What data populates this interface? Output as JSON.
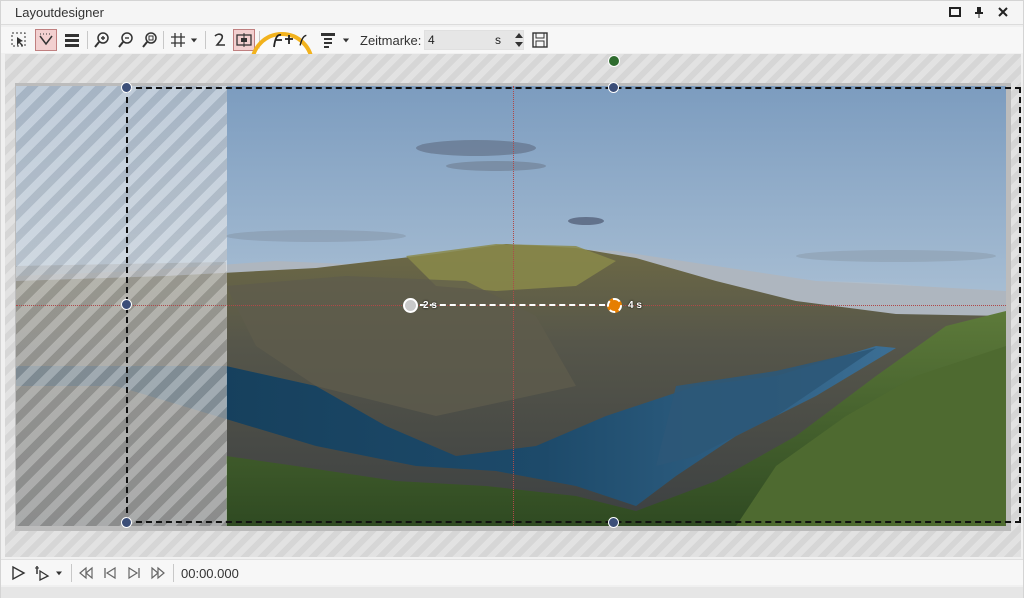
{
  "window": {
    "title": "Layoutdesigner"
  },
  "toolbar": {
    "zeitmarke_label": "Zeitmarke:",
    "zeitmarke_value": "4",
    "zeitmarke_unit": "s"
  },
  "canvas": {
    "keyframe_start_label": "2 s",
    "keyframe_end_label": "4 s"
  },
  "status": {
    "time": "00:00.000"
  },
  "colors": {
    "highlight": "#f2b21d",
    "handle": "#3b4e78",
    "rotation_handle": "#2e6b2e",
    "keyframe_end": "#e67e00",
    "guide": "#b04848"
  },
  "icons": [
    "select-icon",
    "object-select-icon",
    "layers-icon",
    "zoom-in-icon",
    "zoom-out-icon",
    "zoom-fit-icon",
    "grid-icon",
    "chevron-down-icon",
    "undo-curve-icon",
    "frame-icon",
    "add-keyframe-path-icon",
    "path-icon",
    "text-format-icon",
    "save-icon",
    "play-icon",
    "play-from-icon",
    "skip-start-icon",
    "prev-frame-icon",
    "next-frame-icon",
    "skip-end-icon"
  ]
}
